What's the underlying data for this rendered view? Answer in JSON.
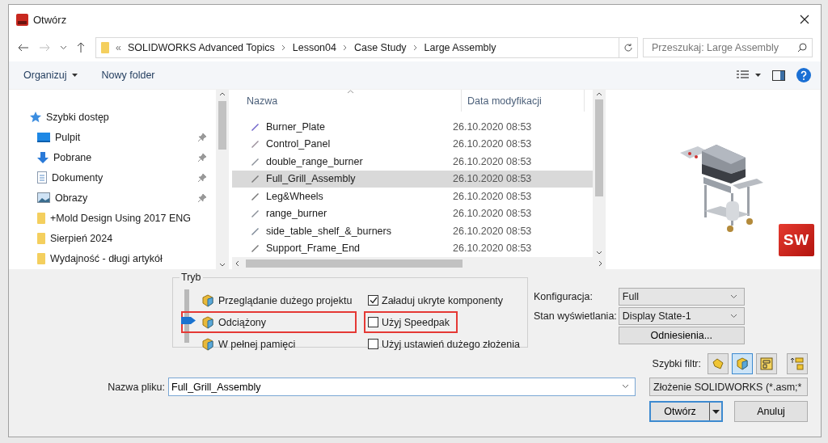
{
  "window": {
    "title": "Otwórz"
  },
  "nav": {
    "overflow": "«",
    "path": [
      "SOLIDWORKS Advanced Topics",
      "Lesson04",
      "Case Study",
      "Large Assembly"
    ],
    "search": {
      "placeholder": "Przeszukaj: Large Assembly"
    }
  },
  "toolbar": {
    "organize": "Organizuj",
    "new_folder": "Nowy folder"
  },
  "sidebar": {
    "items": [
      {
        "label": "Szybki dostęp",
        "kind": "quick",
        "children": [
          {
            "label": "Pulpit",
            "kind": "desktop",
            "pinned": true
          },
          {
            "label": "Pobrane",
            "kind": "download",
            "pinned": true
          },
          {
            "label": "Dokumenty",
            "kind": "documents",
            "pinned": true
          },
          {
            "label": "Obrazy",
            "kind": "pictures",
            "pinned": true
          },
          {
            "label": "+Mold Design Using 2017 ENG",
            "kind": "folder",
            "pinned": false
          },
          {
            "label": "Sierpień 2024",
            "kind": "folder",
            "pinned": false
          },
          {
            "label": "Wydajność - długi artykół",
            "kind": "folder",
            "pinned": false
          }
        ]
      }
    ]
  },
  "file_list": {
    "columns": [
      "Nazwa",
      "Data modyfikacji"
    ],
    "rows": [
      {
        "name": "Burner_Plate",
        "modified": "26.10.2020 08:53",
        "selected": false
      },
      {
        "name": "Control_Panel",
        "modified": "26.10.2020 08:53",
        "selected": false
      },
      {
        "name": "double_range_burner",
        "modified": "26.10.2020 08:53",
        "selected": false
      },
      {
        "name": "Full_Grill_Assembly",
        "modified": "26.10.2020 08:53",
        "selected": true
      },
      {
        "name": "Leg&Wheels",
        "modified": "26.10.2020 08:53",
        "selected": false
      },
      {
        "name": "range_burner",
        "modified": "26.10.2020 08:53",
        "selected": false
      },
      {
        "name": "side_table_shelf_&_burners",
        "modified": "26.10.2020 08:53",
        "selected": false
      },
      {
        "name": "Support_Frame_End",
        "modified": "26.10.2020 08:53",
        "selected": false
      }
    ]
  },
  "preview": {
    "kind": "picture",
    "logo_text": "SW"
  },
  "mode_group": {
    "title": "Tryb",
    "modes": [
      {
        "label": "Przeglądanie dużego projektu",
        "selected": false,
        "highlighted": false
      },
      {
        "label": "Odciążony",
        "selected": true,
        "highlighted": true
      },
      {
        "label": "W pełnej pamięci",
        "selected": false,
        "highlighted": false
      }
    ],
    "checkboxes": [
      {
        "label": "Załaduj ukryte komponenty",
        "checked": true,
        "highlighted": false
      },
      {
        "label": "Użyj Speedpak",
        "checked": false,
        "highlighted": true
      },
      {
        "label": "Użyj ustawień dużego złożenia",
        "checked": false,
        "highlighted": false
      }
    ]
  },
  "configuration": {
    "label": "Konfiguracja:",
    "value": "Full"
  },
  "display_state": {
    "label": "Stan wyświetlania:",
    "value": "Display State-1"
  },
  "references_button": "Odniesienia...",
  "quick_filter": {
    "label": "Szybki filtr:",
    "buttons": [
      {
        "kind": "part",
        "selected": false
      },
      {
        "kind": "assembly",
        "selected": true
      },
      {
        "kind": "drawing",
        "selected": false
      },
      {
        "kind": "top_level",
        "selected": false
      }
    ]
  },
  "file_name": {
    "label": "Nazwa pliku:",
    "value": "Full_Grill_Assembly"
  },
  "file_type": "Złożenie SOLIDWORKS (*.asm;*",
  "buttons": {
    "open": "Otwórz",
    "cancel": "Anuluj"
  }
}
